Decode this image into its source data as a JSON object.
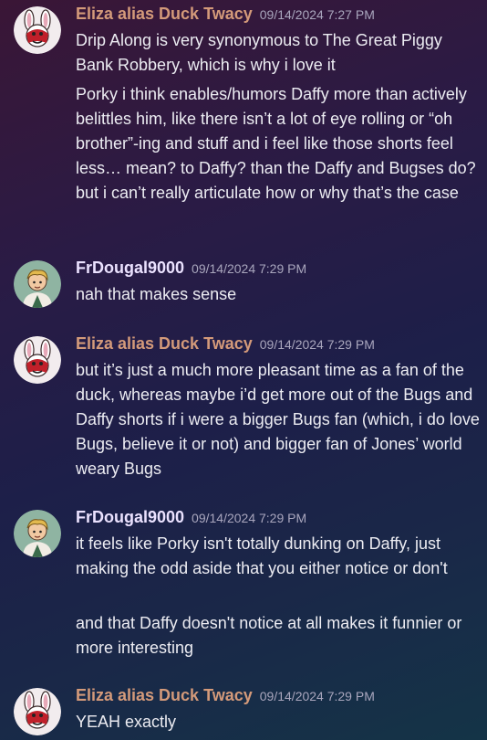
{
  "colors": {
    "eliza_name": "#d49a7a",
    "frdougal_name": "#ebe2ff"
  },
  "messages": [
    {
      "author": "Eliza alias Duck Twacy",
      "timestamp": "09/14/2024 7:27 PM",
      "avatar": "eliza-avatar",
      "texts": [
        "Drip Along is very synonymous to The Great Piggy Bank Robbery, which is why i love it",
        "Porky i think enables/humors Daffy more than actively belittles him, like there isn’t a lot of eye rolling or “oh brother”-ing and stuff and i feel like those shorts feel less… mean? to Daffy? than the Daffy and Bugses do? but i can’t really articulate how or why that’s the case"
      ]
    },
    {
      "author": "FrDougal9000",
      "timestamp": "09/14/2024 7:29 PM",
      "avatar": "frdougal-avatar",
      "texts": [
        "nah that makes sense"
      ]
    },
    {
      "author": "Eliza alias Duck Twacy",
      "timestamp": "09/14/2024 7:29 PM",
      "avatar": "eliza-avatar",
      "texts": [
        "but it’s just a much more pleasant time as a fan of the duck, whereas maybe i’d get more out of the Bugs and Daffy shorts if i were a bigger Bugs fan (which, i do love Bugs, believe it or not) and bigger fan of Jones’ world weary Bugs"
      ]
    },
    {
      "author": "FrDougal9000",
      "timestamp": "09/14/2024 7:29 PM",
      "avatar": "frdougal-avatar",
      "texts": [
        "it feels like Porky isn't totally dunking on Daffy, just making the odd aside that you either notice or don't",
        "and that Daffy doesn't notice at all makes it funnier or more interesting"
      ]
    },
    {
      "author": "Eliza alias Duck Twacy",
      "timestamp": "09/14/2024 7:29 PM",
      "avatar": "eliza-avatar",
      "texts": [
        "YEAH exactly"
      ]
    }
  ]
}
